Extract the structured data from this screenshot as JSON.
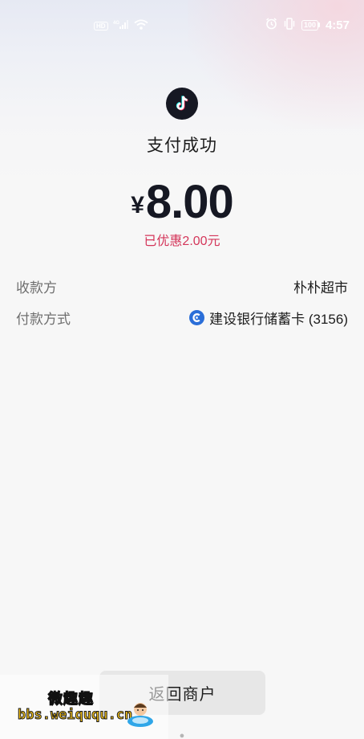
{
  "status_bar": {
    "left_badge": "HD",
    "signal": "4G",
    "battery": "100",
    "time": "4:57"
  },
  "header": {
    "app_icon": "tiktok-icon",
    "title": "支付成功"
  },
  "amount": {
    "currency": "¥",
    "value": "8.00",
    "discount_text": "已优惠2.00元"
  },
  "details": [
    {
      "label": "收款方",
      "value": "朴朴超市"
    },
    {
      "label": "付款方式",
      "value": "建设银行储蓄卡 (3156)",
      "icon": "ccb-bank-icon"
    }
  ],
  "actions": {
    "return_label": "返回商户"
  },
  "watermark": {
    "line1": "微趣趣",
    "line2": "bbs.weiququ.cn"
  },
  "colors": {
    "accent_discount": "#d4365a",
    "bank_icon": "#2a6ed8",
    "button_bg": "#e7e7e7"
  }
}
